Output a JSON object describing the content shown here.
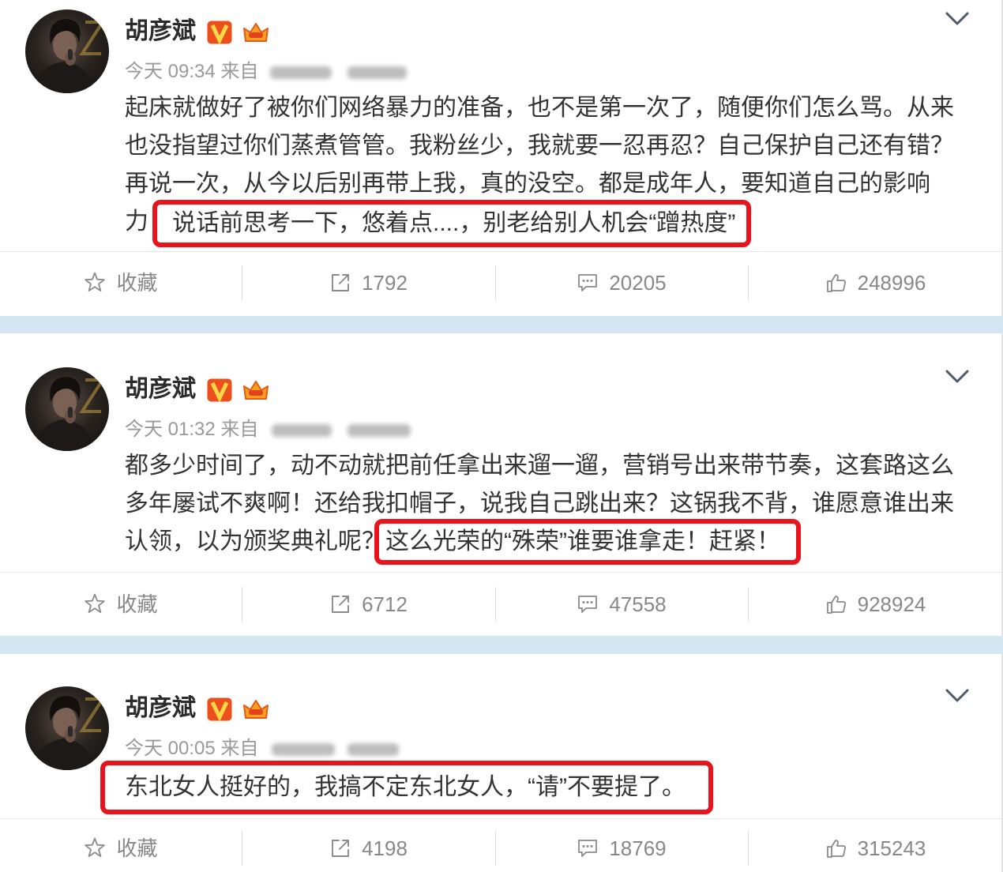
{
  "colors": {
    "highlight_border": "#e8131b",
    "band": "#d3e6f2",
    "text": "#333333",
    "meta": "#999999",
    "action": "#888888",
    "verified_badge": "#ec4f1c",
    "verified_badge_mark": "#ffd84a",
    "crown": "#f8a01c"
  },
  "icons": {
    "menu": "chevron-down-icon",
    "verified": "verified-v-badge-icon",
    "member": "crown-icon",
    "favorite": "star-icon",
    "repost": "share-icon",
    "comment": "comment-icon",
    "like": "thumbs-up-icon"
  },
  "posts": [
    {
      "author": "胡彦斌",
      "time": "今天 09:34 来自",
      "lines": [
        "起床就做好了被你们网络暴力的准备，也不是第一次了，随便你们怎么骂。从来",
        "也没指望过你们蒸煮管管。我粉丝少，我就要一忍再忍？自己保护自己还有错？",
        "再说一次，从今以后别再带上我，真的没空。都是成年人，要知道自己的影响",
        "力"
      ],
      "highlight": "说话前思考一下，悠着点....，别老给别人机会“蹭热度”",
      "actions": {
        "favorite": "收藏",
        "repost": "1792",
        "comment": "20205",
        "like": "248996"
      }
    },
    {
      "author": "胡彦斌",
      "time": "今天 01:32 来自",
      "lines": [
        "都多少时间了，动不动就把前任拿出来遛一遛，营销号出来带节奏，这套路这么",
        "多年屡试不爽啊！还给我扣帽子，说我自己跳出来？这锅我不背，谁愿意谁出来",
        "认领，以为颁奖典礼呢？"
      ],
      "highlight": "这么光荣的“殊荣”谁要谁拿走！赶紧！",
      "actions": {
        "favorite": "收藏",
        "repost": "6712",
        "comment": "47558",
        "like": "928924"
      }
    },
    {
      "author": "胡彦斌",
      "time": "今天 00:05 来自",
      "lines": [],
      "highlight": "东北女人挺好的，我搞不定东北女人，“请”不要提了。",
      "actions": {
        "favorite": "收藏",
        "repost": "4198",
        "comment": "18769",
        "like": "315243"
      }
    }
  ]
}
